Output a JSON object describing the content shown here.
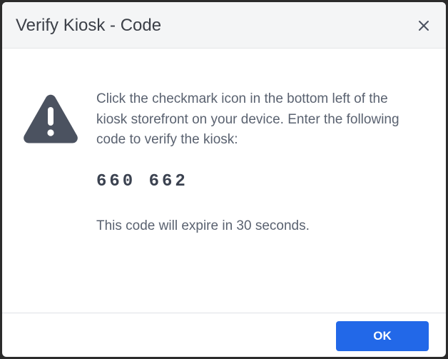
{
  "dialog": {
    "title": "Verify Kiosk - Code",
    "close_icon": "close-icon",
    "warning_icon": "warning-triangle-icon",
    "message": "Click the checkmark icon in the bottom left of the kiosk storefront on your device. Enter the following code to verify the kiosk:",
    "code": "660 662",
    "expiry_text": "This code will expire in 30 seconds.",
    "ok_label": "OK"
  },
  "colors": {
    "accent": "#2268e8",
    "header_bg": "#f4f5f6",
    "icon": "#4b5260",
    "text": "#5a6270"
  }
}
